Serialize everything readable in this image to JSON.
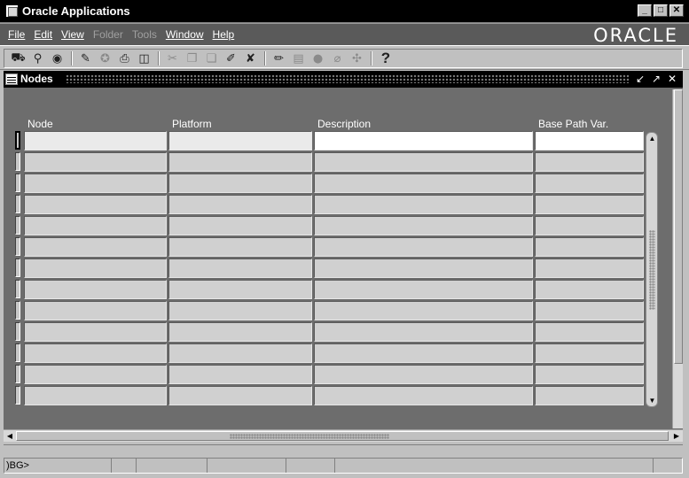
{
  "window": {
    "title": "Oracle Applications",
    "controls": [
      "_",
      "□",
      "✕"
    ]
  },
  "menubar": {
    "items": [
      {
        "label": "File",
        "enabled": true
      },
      {
        "label": "Edit",
        "enabled": true
      },
      {
        "label": "View",
        "enabled": true
      },
      {
        "label": "Folder",
        "enabled": false
      },
      {
        "label": "Tools",
        "enabled": false
      },
      {
        "label": "Window",
        "enabled": true
      },
      {
        "label": "Help",
        "enabled": true
      }
    ],
    "brand": "ORACLE"
  },
  "toolbar": {
    "icons": [
      "new-icon",
      "find-icon",
      "show-navigator-icon",
      "save-icon",
      "next-step-icon",
      "print-icon",
      "close-form-icon",
      "cut-icon",
      "copy-icon",
      "paste-icon",
      "new-record-icon",
      "delete-record-icon",
      "edit-field-icon",
      "zoom-icon",
      "translations-icon",
      "attachments-icon",
      "folder-tools-icon",
      "help-icon"
    ],
    "help_glyph": "?"
  },
  "form": {
    "title": "Nodes",
    "inner_controls": [
      "↙",
      "↗",
      "✕"
    ],
    "columns": [
      {
        "key": "node",
        "label": "Node"
      },
      {
        "key": "platform",
        "label": "Platform"
      },
      {
        "key": "description",
        "label": "Description"
      },
      {
        "key": "base_path",
        "label": "Base Path Var."
      }
    ],
    "row_count": 13
  },
  "status": {
    "text": ")BG>"
  },
  "colors": {
    "titlebar": "#000000",
    "menubar": "#5a5a5a",
    "canvas": "#6d6d6d",
    "field": "#d0d0d0",
    "field_active": "#ffffff"
  }
}
